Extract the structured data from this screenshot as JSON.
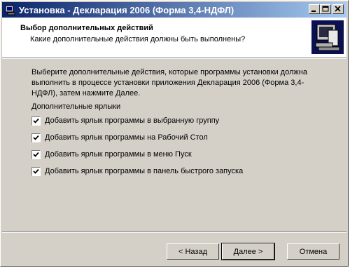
{
  "window": {
    "title": "Установка - Декларация 2006 (Форма 3,4-НДФЛ)"
  },
  "header": {
    "title": "Выбор дополнительных действий",
    "subtitle": "Какие дополнительные действия должны быть выполнены?"
  },
  "content": {
    "description": "Выберите дополнительные действия, которые программы установки должна выполнить в процессе установки приложения Декларация 2006 (Форма 3,4-НДФЛ), затем нажмите Далее.",
    "group_label": "Дополнительные ярлыки",
    "options": [
      {
        "label": "Добавить ярлык программы в выбранную группу",
        "checked": true
      },
      {
        "label": "Добавить ярлык программы на Рабочий Стол",
        "checked": true
      },
      {
        "label": "Добавить ярлык программы в меню Пуск",
        "checked": true
      },
      {
        "label": "Добавить ярлык программы в панель быстрого запуска",
        "checked": true
      }
    ]
  },
  "buttons": {
    "back": "< Назад",
    "next": "Далее >",
    "cancel": "Отмена"
  },
  "colors": {
    "titlebar_start": "#0a246a",
    "titlebar_end": "#a6caf0",
    "face": "#d4d0c8"
  }
}
